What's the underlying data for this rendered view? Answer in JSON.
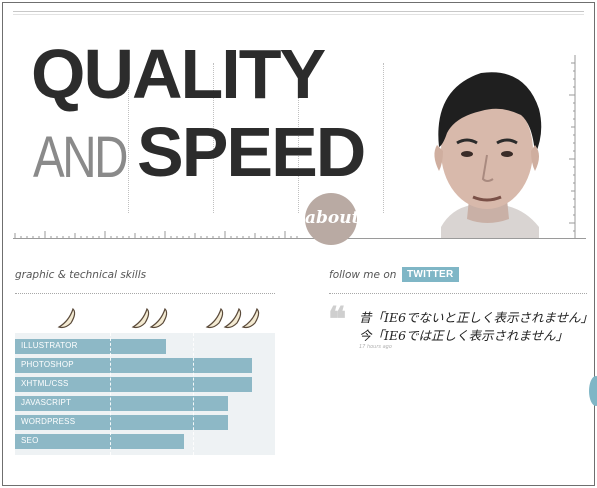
{
  "hero": {
    "line1": "QUALITY",
    "line2_light": "AND",
    "line2_bold": "SPEED",
    "about_badge": "about"
  },
  "skills": {
    "title": "graphic & technical skills",
    "items": [
      {
        "label": "ILLUSTRATOR",
        "level": 0.58
      },
      {
        "label": "PHOTOSHOP",
        "level": 0.91
      },
      {
        "label": "XHTML/CSS",
        "level": 0.91
      },
      {
        "label": "JAVASCRIPT",
        "level": 0.82
      },
      {
        "label": "WORDPRESS",
        "level": 0.82
      },
      {
        "label": "SEO",
        "level": 0.65
      }
    ],
    "scale_icons": [
      "banana-icon",
      "banana-icon",
      "banana-icon",
      "banana-icon",
      "banana-icon",
      "banana-icon"
    ],
    "bar_color": "#8db8c6"
  },
  "social": {
    "title": "follow me on",
    "badge": "TWITTER",
    "tweet_line1": "昔「IE6でないと正しく表示されません」",
    "tweet_line2": "今「IE6では正しく表示されません」",
    "tweet_time": "17 hours ago",
    "accent": "#7fb6c6"
  }
}
